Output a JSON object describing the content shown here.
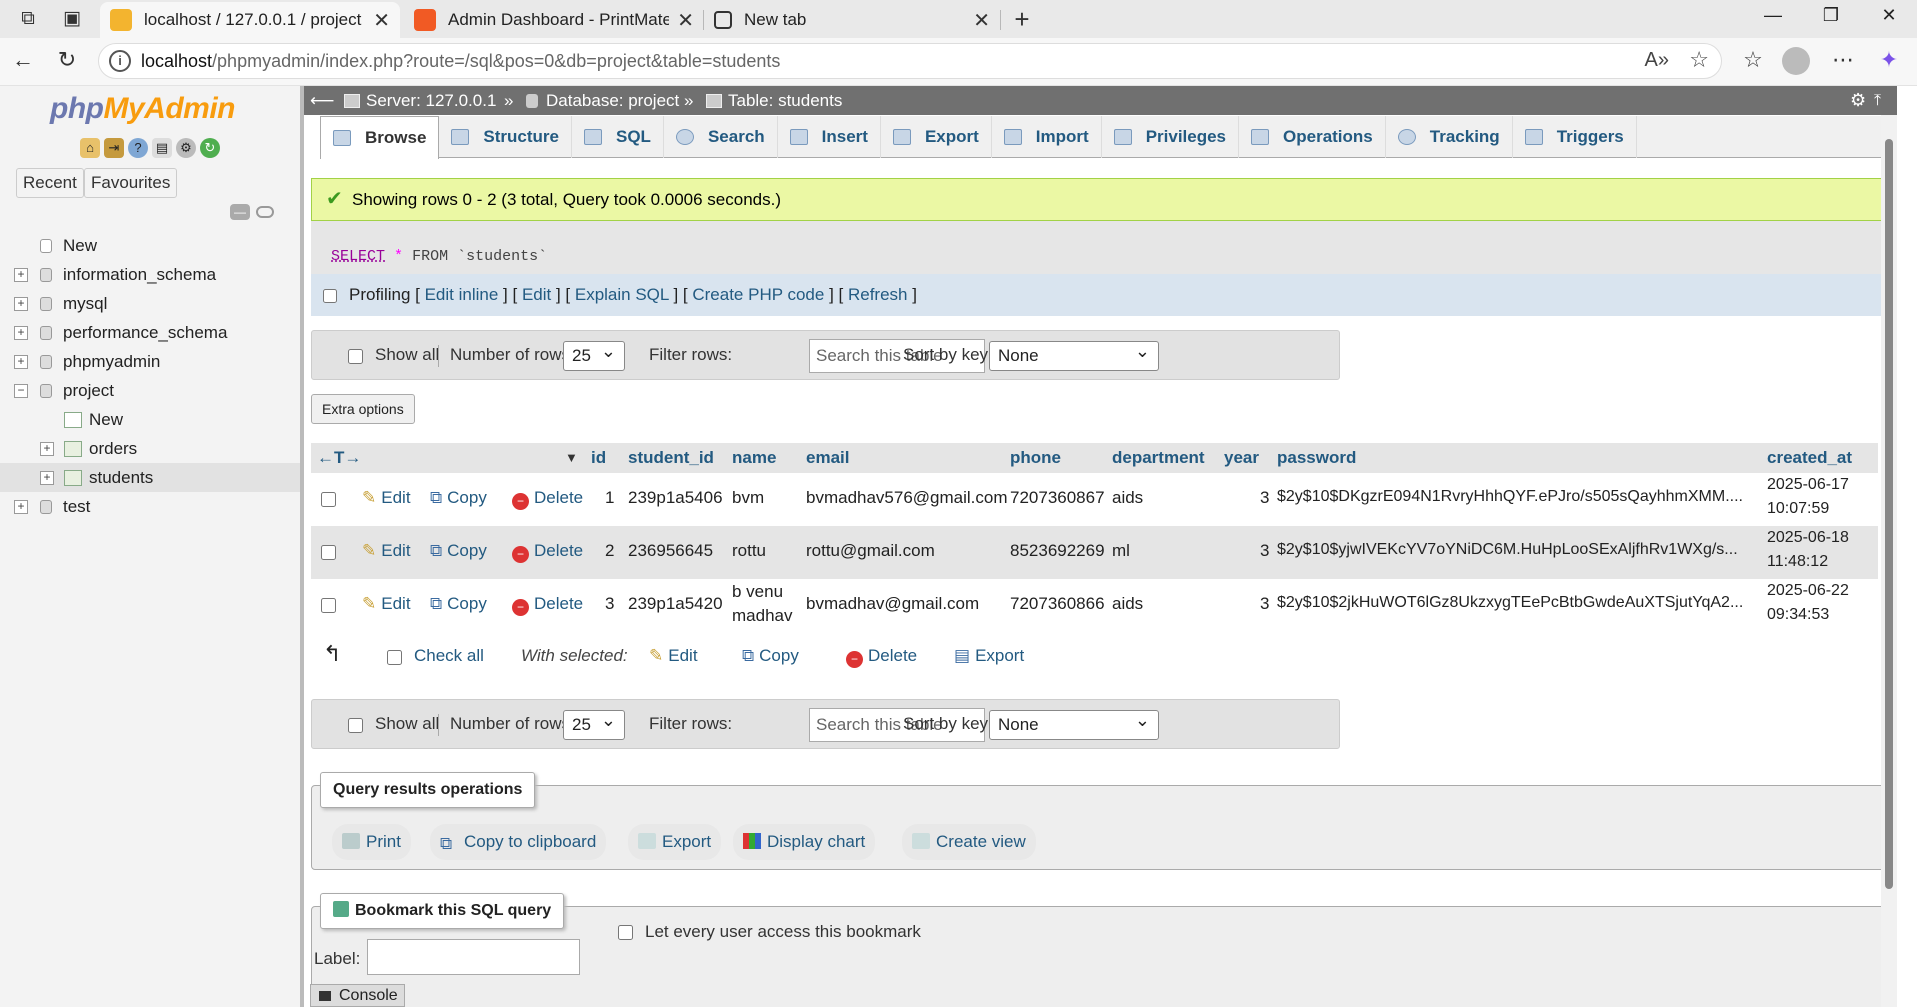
{
  "browser": {
    "tabs": [
      {
        "title": "localhost / 127.0.0.1 / project / students",
        "active": true
      },
      {
        "title": "Admin Dashboard - PrintMate",
        "active": false
      },
      {
        "title": "New tab",
        "active": false
      }
    ],
    "url_host": "localhost",
    "url_rest": "/phpmyadmin/index.php?route=/sql&pos=0&db=project&table=students"
  },
  "sidebar": {
    "logo_a": "php",
    "logo_b": "MyAdmin",
    "recent": "Recent",
    "favourites": "Favourites",
    "tree": [
      {
        "label": "New",
        "level": 0
      },
      {
        "label": "information_schema",
        "level": 0
      },
      {
        "label": "mysql",
        "level": 0
      },
      {
        "label": "performance_schema",
        "level": 0
      },
      {
        "label": "phpmyadmin",
        "level": 0
      },
      {
        "label": "project",
        "level": 0
      },
      {
        "label": "New",
        "level": 1
      },
      {
        "label": "orders",
        "level": 1
      },
      {
        "label": "students",
        "level": 1
      },
      {
        "label": "test",
        "level": 0
      }
    ]
  },
  "breadcrumb": {
    "server": "Server: 127.0.0.1",
    "database": "Database: project",
    "table": "Table: students",
    "sep": "»"
  },
  "tabs": [
    "Browse",
    "Structure",
    "SQL",
    "Search",
    "Insert",
    "Export",
    "Import",
    "Privileges",
    "Operations",
    "Tracking",
    "Triggers"
  ],
  "message": "Showing rows 0 - 2 (3 total, Query took 0.0006 seconds.)",
  "sql": {
    "select": "SELECT",
    "star": "*",
    "from": "FROM",
    "table": "`students`"
  },
  "profiling": {
    "label": "Profiling",
    "edit_inline": "Edit inline",
    "edit": "Edit",
    "explain": "Explain SQL",
    "php": "Create PHP code",
    "refresh": "Refresh"
  },
  "navbar": {
    "show_all": "Show all",
    "num_rows_label": "Number of rows:",
    "num_rows": "25",
    "filter_label": "Filter rows:",
    "filter_placeholder": "Search this table",
    "sort_label": "Sort by key:",
    "sort_value": "None"
  },
  "extra_options": "Extra options",
  "table": {
    "columns": [
      "id",
      "student_id",
      "name",
      "email",
      "phone",
      "department",
      "year",
      "password",
      "created_at"
    ],
    "actions": {
      "edit": "Edit",
      "copy": "Copy",
      "delete": "Delete"
    },
    "rows": [
      {
        "id": "1",
        "student_id": "239p1a5406",
        "name": "bvm",
        "name2": "",
        "email": "bvmadhav576@gmail.com",
        "phone": "7207360867",
        "department": "aids",
        "year": "3",
        "password": "$2y$10$DKgzrE094N1RvryHhhQYF.ePJro/s505sQayhhmXMM....",
        "created_date": "2025-06-17",
        "created_time": "10:07:59"
      },
      {
        "id": "2",
        "student_id": "236956645",
        "name": "rottu",
        "name2": "",
        "email": "rottu@gmail.com",
        "phone": "8523692269",
        "department": "ml",
        "year": "3",
        "password": "$2y$10$yjwIVEKcYV7oYNiDC6M.HuHpLooSExAljfhRv1WXg/s...",
        "created_date": "2025-06-18",
        "created_time": "11:48:12"
      },
      {
        "id": "3",
        "student_id": "239p1a5420",
        "name": "b venu",
        "name2": "madhav",
        "email": "bvmadhav@gmail.com",
        "phone": "7207360866",
        "department": "aids",
        "year": "3",
        "password": "$2y$10$2jkHuWOT6lGz8UkzxygTEePcBtbGwdeAuXTSjutYqA2...",
        "created_date": "2025-06-22",
        "created_time": "09:34:53"
      }
    ]
  },
  "with_selected": {
    "check_all": "Check all",
    "label": "With selected:",
    "edit": "Edit",
    "copy": "Copy",
    "delete": "Delete",
    "export": "Export"
  },
  "query_ops": {
    "legend": "Query results operations",
    "print": "Print",
    "clipboard": "Copy to clipboard",
    "export": "Export",
    "chart": "Display chart",
    "view": "Create view"
  },
  "bookmark": {
    "legend": "Bookmark this SQL query",
    "label": "Label:",
    "every_user": "Let every user access this bookmark"
  },
  "console": "Console"
}
